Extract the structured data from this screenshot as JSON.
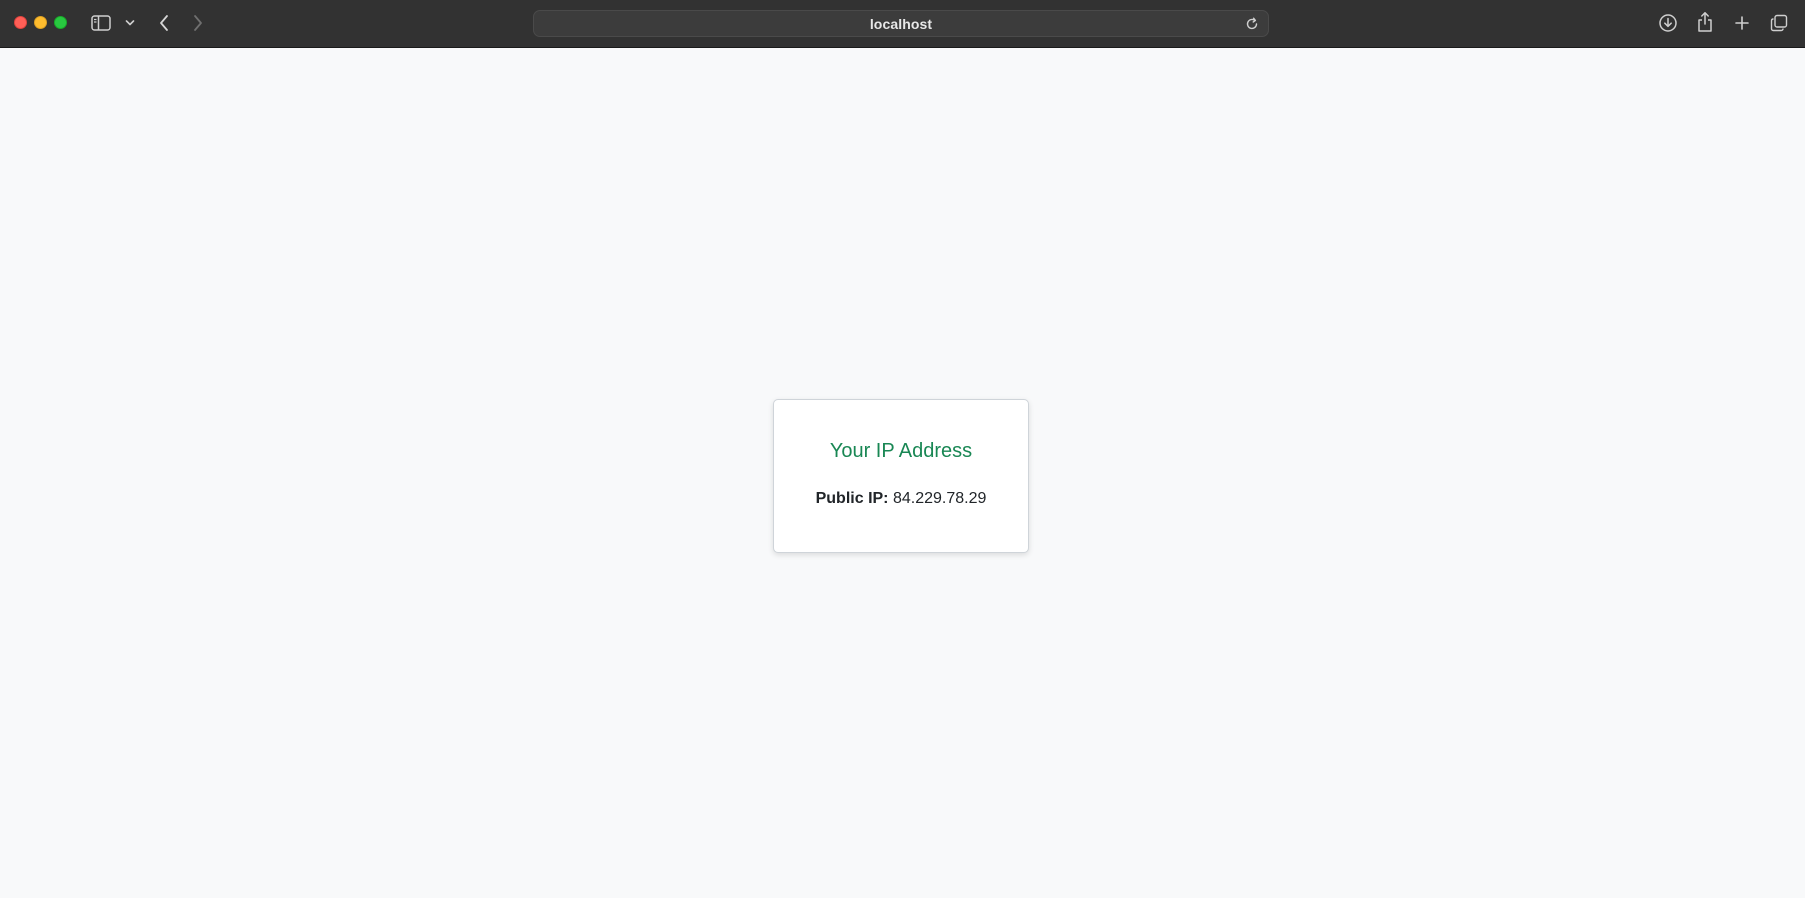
{
  "browser": {
    "address": "localhost",
    "icons": {
      "close": "close-window-dot",
      "minimize": "minimize-window-dot",
      "zoom": "zoom-window-dot",
      "sidebar": "sidebar-icon",
      "sidebar_menu": "chevron-down-icon",
      "back": "chevron-left-icon",
      "forward": "chevron-right-icon",
      "reload": "reload-icon",
      "downloads": "download-icon",
      "share": "share-icon",
      "new_tab": "plus-icon",
      "tab_overview": "tabs-overview-icon"
    },
    "colors": {
      "toolbar": "#323232",
      "close": "#ff5f57",
      "minimize": "#febc2e",
      "zoom": "#28c840"
    }
  },
  "page": {
    "card": {
      "title": "Your IP Address",
      "ip_label": "Public IP:",
      "ip_value": "84.229.78.29"
    },
    "colors": {
      "background": "#f8f9fa",
      "title": "#198754",
      "text": "#212529"
    }
  }
}
